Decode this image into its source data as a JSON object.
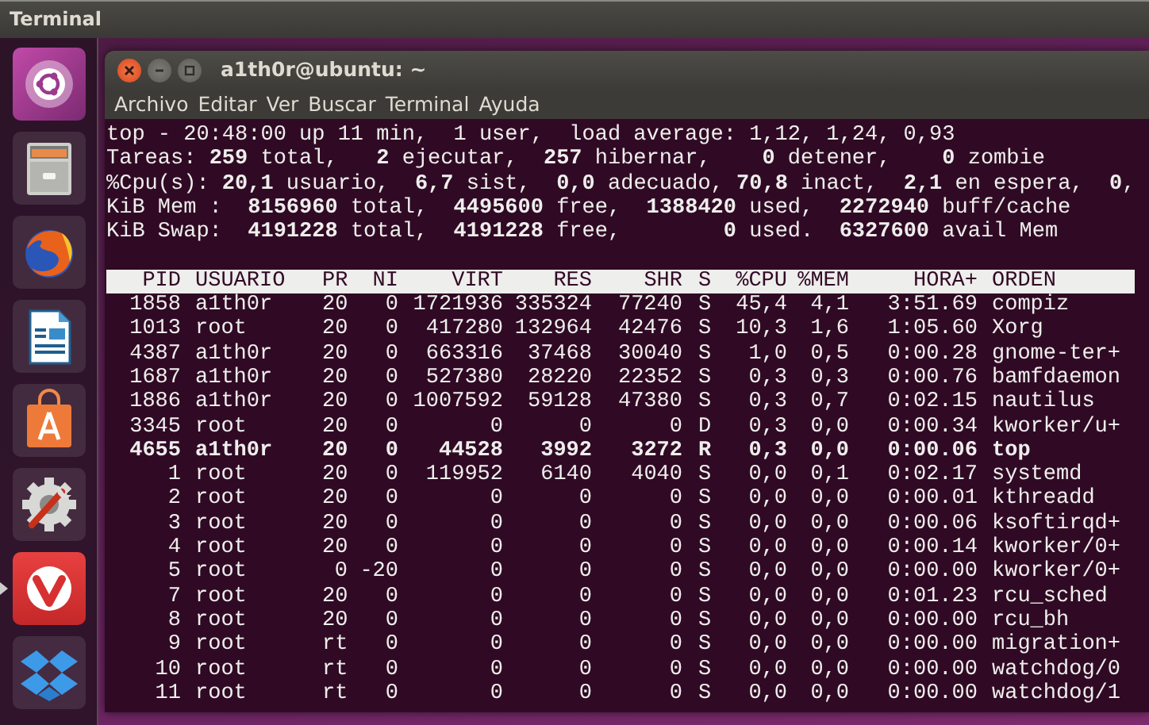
{
  "top_panel": {
    "title": "Terminal"
  },
  "launcher": [
    {
      "kind": "dash",
      "running": false
    },
    {
      "kind": "files",
      "running": false
    },
    {
      "kind": "browser",
      "running": false
    },
    {
      "kind": "writer",
      "running": false
    },
    {
      "kind": "software",
      "running": false
    },
    {
      "kind": "settings",
      "running": false
    },
    {
      "kind": "vivaldi",
      "running": true
    },
    {
      "kind": "dropbox",
      "running": false
    }
  ],
  "window": {
    "title": "a1th0r@ubuntu: ~",
    "menu": [
      "Archivo",
      "Editar",
      "Ver",
      "Buscar",
      "Terminal",
      "Ayuda"
    ]
  },
  "summary": [
    "top - 20:48:00 up 11 min,  1 user,  load average: 1,12, 1,24, 0,93",
    "Tareas: **259** total,   **2** ejecutar,  **257** hibernar,    **0** detener,    **0** zombie",
    "%Cpu(s): **20,1** usuario,  **6,7** sist,  **0,0** adecuado, **70,8** inact,  **2,1** en espera,  **0**,",
    "KiB Mem :  **8156960** total,  **4495600** free,  **1388420** used,  **2272940** buff/cache",
    "KiB Swap:  **4191228** total,  **4191228** free,        **0** used.  **6327600** avail Mem"
  ],
  "table": {
    "columns": [
      "PID",
      "USUARIO",
      "PR",
      "NI",
      "VIRT",
      "RES",
      "SHR",
      "S",
      "%CPU",
      "%MEM",
      "HORA+",
      "ORDEN"
    ],
    "rows": [
      {
        "cells": [
          "1858",
          "a1th0r",
          "20",
          "0",
          "1721936",
          "335324",
          "77240",
          "S",
          "45,4",
          "4,1",
          "3:51.69",
          "compiz"
        ],
        "highlighted": false
      },
      {
        "cells": [
          "1013",
          "root",
          "20",
          "0",
          "417280",
          "132964",
          "42476",
          "S",
          "10,3",
          "1,6",
          "1:05.60",
          "Xorg"
        ],
        "highlighted": false
      },
      {
        "cells": [
          "4387",
          "a1th0r",
          "20",
          "0",
          "663316",
          "37468",
          "30040",
          "S",
          "1,0",
          "0,5",
          "0:00.28",
          "gnome-ter+"
        ],
        "highlighted": false
      },
      {
        "cells": [
          "1687",
          "a1th0r",
          "20",
          "0",
          "527380",
          "28220",
          "22352",
          "S",
          "0,3",
          "0,3",
          "0:00.76",
          "bamfdaemon"
        ],
        "highlighted": false
      },
      {
        "cells": [
          "1886",
          "a1th0r",
          "20",
          "0",
          "1007592",
          "59128",
          "47380",
          "S",
          "0,3",
          "0,7",
          "0:02.15",
          "nautilus"
        ],
        "highlighted": false
      },
      {
        "cells": [
          "3345",
          "root",
          "20",
          "0",
          "0",
          "0",
          "0",
          "D",
          "0,3",
          "0,0",
          "0:00.34",
          "kworker/u+"
        ],
        "highlighted": false
      },
      {
        "cells": [
          "4655",
          "a1th0r",
          "20",
          "0",
          "44528",
          "3992",
          "3272",
          "R",
          "0,3",
          "0,0",
          "0:00.06",
          "top"
        ],
        "highlighted": true
      },
      {
        "cells": [
          "1",
          "root",
          "20",
          "0",
          "119952",
          "6140",
          "4040",
          "S",
          "0,0",
          "0,1",
          "0:02.17",
          "systemd"
        ],
        "highlighted": false
      },
      {
        "cells": [
          "2",
          "root",
          "20",
          "0",
          "0",
          "0",
          "0",
          "S",
          "0,0",
          "0,0",
          "0:00.01",
          "kthreadd"
        ],
        "highlighted": false
      },
      {
        "cells": [
          "3",
          "root",
          "20",
          "0",
          "0",
          "0",
          "0",
          "S",
          "0,0",
          "0,0",
          "0:00.06",
          "ksoftirqd+"
        ],
        "highlighted": false
      },
      {
        "cells": [
          "4",
          "root",
          "20",
          "0",
          "0",
          "0",
          "0",
          "S",
          "0,0",
          "0,0",
          "0:00.14",
          "kworker/0+"
        ],
        "highlighted": false
      },
      {
        "cells": [
          "5",
          "root",
          "0",
          "-20",
          "0",
          "0",
          "0",
          "S",
          "0,0",
          "0,0",
          "0:00.00",
          "kworker/0+"
        ],
        "highlighted": false
      },
      {
        "cells": [
          "7",
          "root",
          "20",
          "0",
          "0",
          "0",
          "0",
          "S",
          "0,0",
          "0,0",
          "0:01.23",
          "rcu_sched"
        ],
        "highlighted": false
      },
      {
        "cells": [
          "8",
          "root",
          "20",
          "0",
          "0",
          "0",
          "0",
          "S",
          "0,0",
          "0,0",
          "0:00.00",
          "rcu_bh"
        ],
        "highlighted": false
      },
      {
        "cells": [
          "9",
          "root",
          "rt",
          "0",
          "0",
          "0",
          "0",
          "S",
          "0,0",
          "0,0",
          "0:00.00",
          "migration+"
        ],
        "highlighted": false
      },
      {
        "cells": [
          "10",
          "root",
          "rt",
          "0",
          "0",
          "0",
          "0",
          "S",
          "0,0",
          "0,0",
          "0:00.00",
          "watchdog/0"
        ],
        "highlighted": false
      },
      {
        "cells": [
          "11",
          "root",
          "rt",
          "0",
          "0",
          "0",
          "0",
          "S",
          "0,0",
          "0,0",
          "0:00.00",
          "watchdog/1"
        ],
        "highlighted": false
      }
    ]
  }
}
